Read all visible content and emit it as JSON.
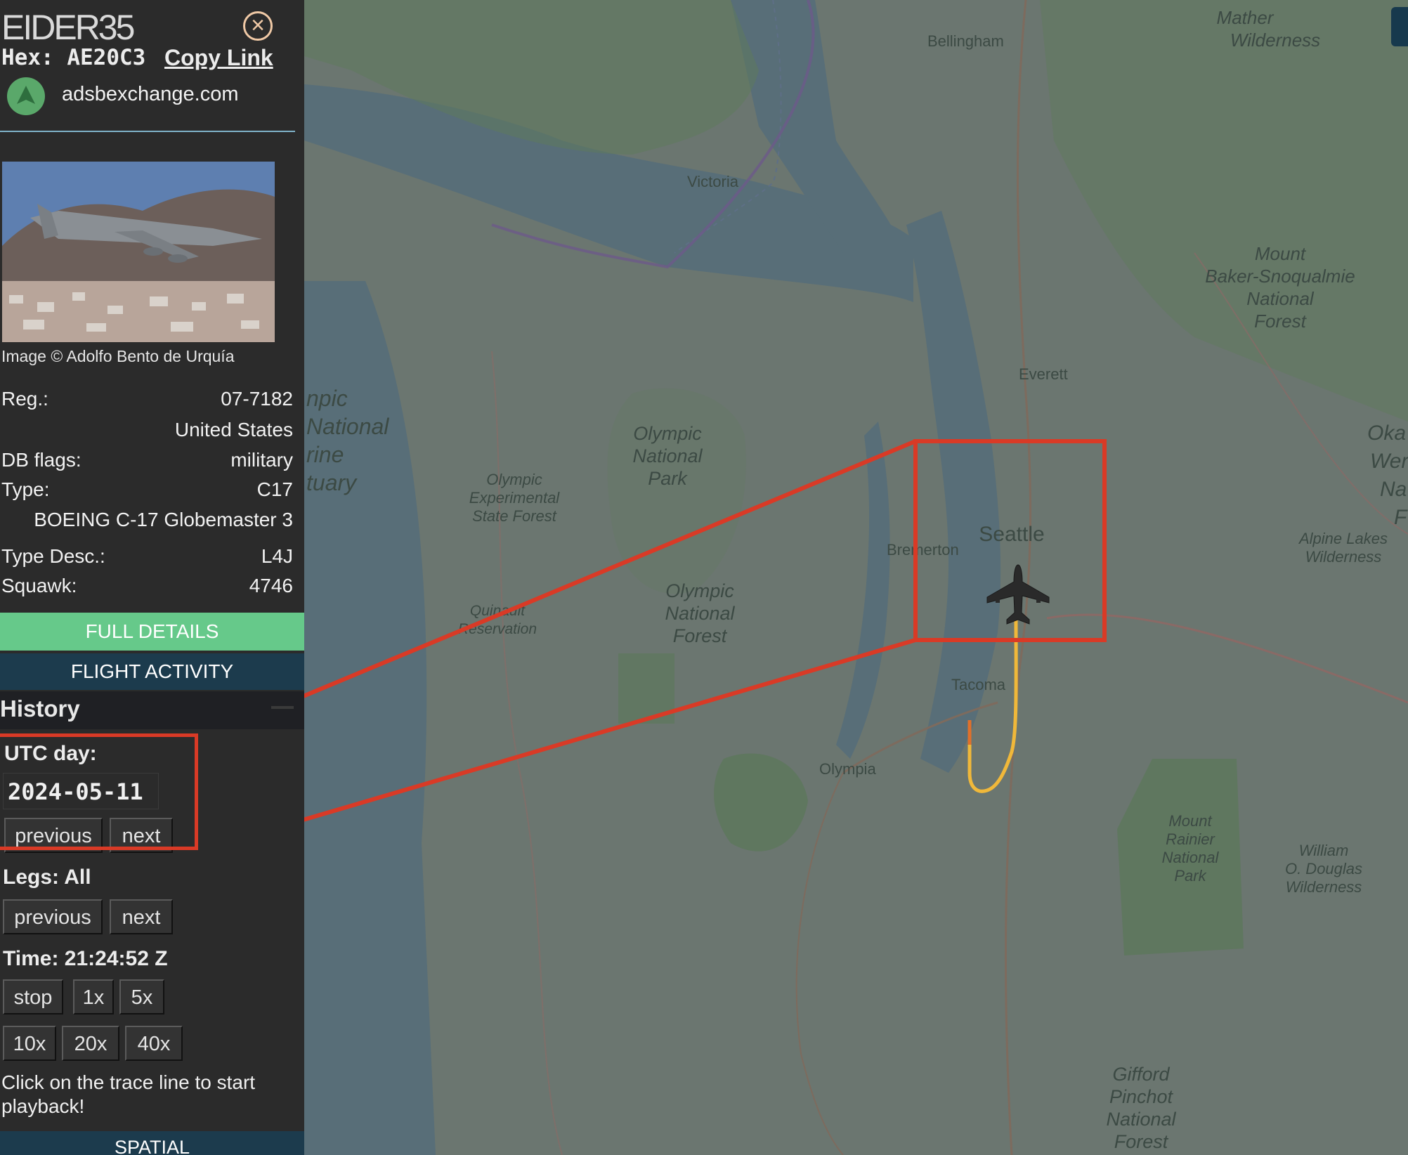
{
  "aircraft": {
    "callsign": "EIDER35",
    "hex_label": "Hex:",
    "hex": "AE20C3",
    "copy_link": "Copy Link",
    "source": "adsbexchange.com",
    "photo_credit": "Image © Adolfo Bento de Urquía"
  },
  "details": [
    {
      "key": "Reg.:",
      "value": "07-7182"
    },
    {
      "key": "",
      "value": "United States"
    },
    {
      "key": "DB flags:",
      "value": "military"
    },
    {
      "key": "Type:",
      "value": "C17"
    },
    {
      "key": "",
      "value": "BOEING C-17 Globemaster 3"
    },
    {
      "key": "Type Desc.:",
      "value": "L4J"
    },
    {
      "key": "Squawk:",
      "value": "4746"
    }
  ],
  "buttons": {
    "full_details": "FULL DETAILS",
    "flight_activity": "FLIGHT ACTIVITY",
    "spatial": "SPATIAL"
  },
  "history": {
    "title": "History",
    "utc_label": "UTC day:",
    "utc_value": "2024-05-11",
    "prev": "previous",
    "next": "next",
    "legs_label": "Legs: All",
    "time_label": "Time: 21:24:52 Z",
    "speeds_row1": [
      "stop",
      "1x",
      "5x"
    ],
    "speeds_row2": [
      "10x",
      "20x",
      "40x"
    ],
    "hint": "Click on the trace line to start playback!"
  },
  "map_labels": {
    "mather": "Mather",
    "wilderness": "Wilderness",
    "bellingham": "Bellingham",
    "victoria": "Victoria",
    "mount": "Mount",
    "baker": "Baker-Snoqualmie",
    "national": "National",
    "forest": "Forest",
    "everett": "Everett",
    "olympic": "Olympic",
    "park": "Park",
    "experimental": "Experimental",
    "state_forest": "State Forest",
    "seattle": "Seattle",
    "bremerton": "Bremerton",
    "alpine": "Alpine Lakes",
    "quinault": "Quinault",
    "reservation": "Reservation",
    "tacoma": "Tacoma",
    "olympia": "Olympia",
    "rainier": "Rainier",
    "william": "William",
    "douglas": "O. Douglas",
    "gifford": "Gifford",
    "pinchot": "Pinchot",
    "npic": "npic",
    "ational": "National",
    "rine": "rine",
    "tuary": "tuary",
    "oka": "Oka",
    "wer": "Wer",
    "na": "Na",
    "f": "F"
  },
  "colors": {
    "highlight": "#d93a26",
    "trace": "#f0b83a",
    "full_details_bg": "#66c98a",
    "flight_activity_bg": "#1c3b4d"
  }
}
